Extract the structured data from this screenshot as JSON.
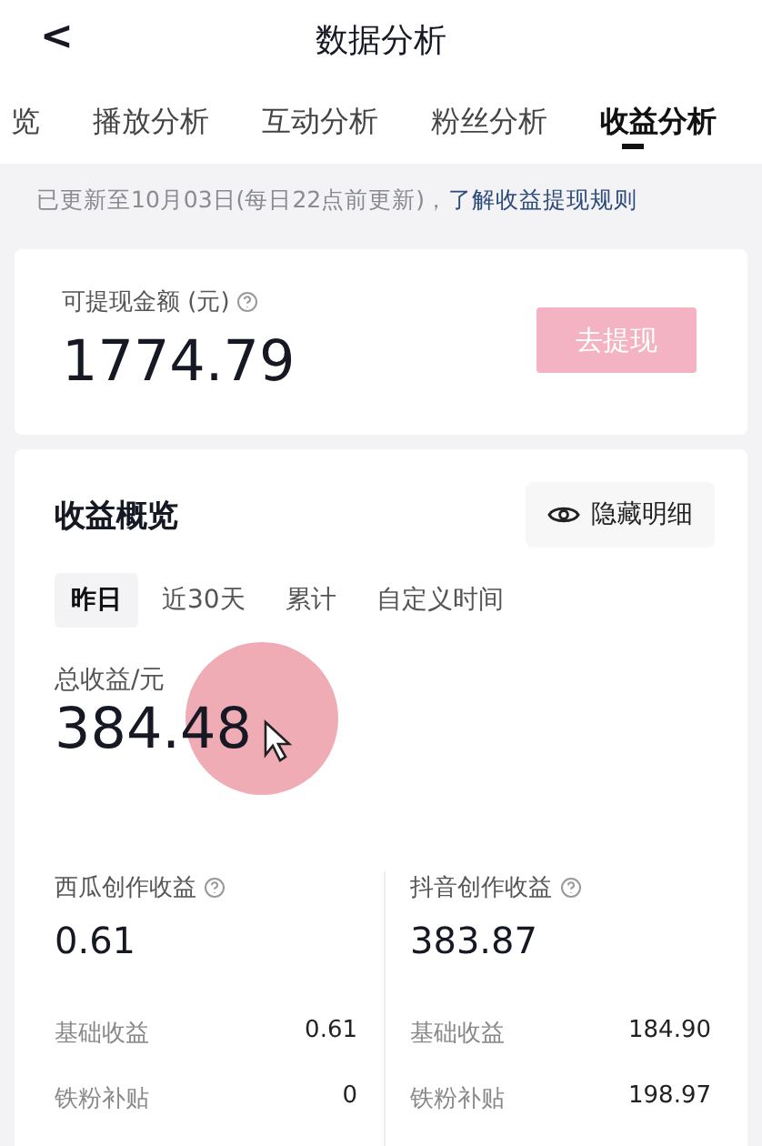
{
  "header": {
    "back_icon": "<",
    "title": "数据分析"
  },
  "tabs": [
    {
      "label": "览",
      "selected": false
    },
    {
      "label": "播放分析",
      "selected": false
    },
    {
      "label": "互动分析",
      "selected": false
    },
    {
      "label": "粉丝分析",
      "selected": false
    },
    {
      "label": "收益分析",
      "selected": true
    }
  ],
  "notice": {
    "text": "已更新至10月03日(每日22点前更新)，",
    "link": "了解收益提现规则"
  },
  "withdraw": {
    "label": "可提现金额 (元)",
    "amount": "1774.79",
    "button": "去提现"
  },
  "overview": {
    "title": "收益概览",
    "hide_button": "隐藏明细",
    "periods": [
      {
        "label": "昨日",
        "selected": true
      },
      {
        "label": "近30天",
        "selected": false
      },
      {
        "label": "累计",
        "selected": false
      },
      {
        "label": "自定义时间",
        "selected": false
      }
    ],
    "total_label": "总收益/元",
    "total": "384.48",
    "sources": [
      {
        "label": "西瓜创作收益",
        "amount": "0.61",
        "rows": [
          {
            "label": "基础收益",
            "value": "0.61"
          },
          {
            "label": "铁粉补贴",
            "value": "0"
          }
        ]
      },
      {
        "label": "抖音创作收益",
        "amount": "383.87",
        "rows": [
          {
            "label": "基础收益",
            "value": "184.90"
          },
          {
            "label": "铁粉补贴",
            "value": "198.97"
          }
        ]
      }
    ]
  }
}
